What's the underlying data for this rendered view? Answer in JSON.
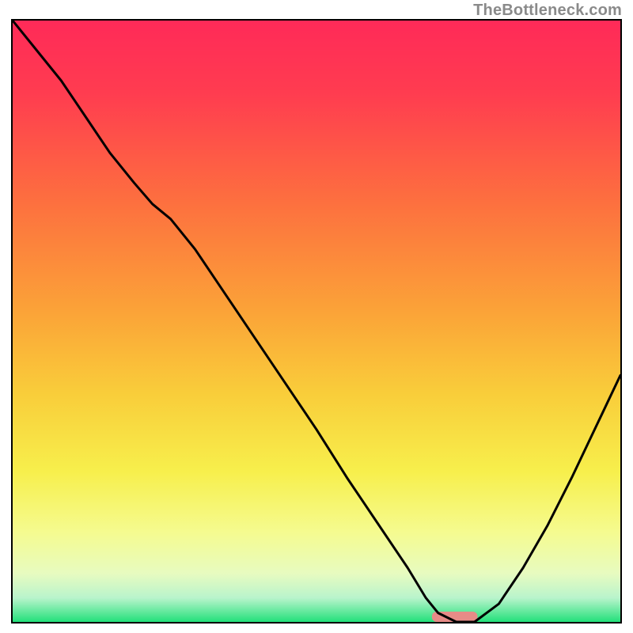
{
  "watermark": "TheBottleneck.com",
  "chart_data": {
    "type": "line",
    "title": "",
    "xlabel": "",
    "ylabel": "",
    "xlim": [
      0,
      100
    ],
    "ylim": [
      0,
      100
    ],
    "grid": false,
    "legend": false,
    "annotations": {
      "marker": {
        "x_range": [
          69,
          76.5
        ],
        "y": 0,
        "color": "#e78b87"
      }
    },
    "gradient_stops": [
      {
        "pct": 0,
        "color": "#ff2a58"
      },
      {
        "pct": 12,
        "color": "#ff3c50"
      },
      {
        "pct": 30,
        "color": "#fd6f3f"
      },
      {
        "pct": 48,
        "color": "#fba238"
      },
      {
        "pct": 62,
        "color": "#f9cd3a"
      },
      {
        "pct": 75,
        "color": "#f7ef4c"
      },
      {
        "pct": 85,
        "color": "#f5fb8f"
      },
      {
        "pct": 92,
        "color": "#e7fbc0"
      },
      {
        "pct": 96,
        "color": "#b9f4cc"
      },
      {
        "pct": 100,
        "color": "#23e07a"
      }
    ],
    "series": [
      {
        "name": "bottleneck-curve",
        "color": "#000000",
        "x": [
          0,
          4,
          8,
          12,
          16,
          20,
          23,
          26,
          30,
          35,
          40,
          45,
          50,
          55,
          60,
          65,
          68,
          70,
          73,
          76,
          80,
          84,
          88,
          92,
          96,
          100
        ],
        "y": [
          100,
          95,
          90,
          84,
          78,
          73,
          69.5,
          67,
          62,
          54.5,
          47,
          39.5,
          32,
          24,
          16.5,
          9,
          4,
          1.5,
          0,
          0,
          3,
          9,
          16,
          24,
          32.5,
          41
        ]
      }
    ]
  }
}
